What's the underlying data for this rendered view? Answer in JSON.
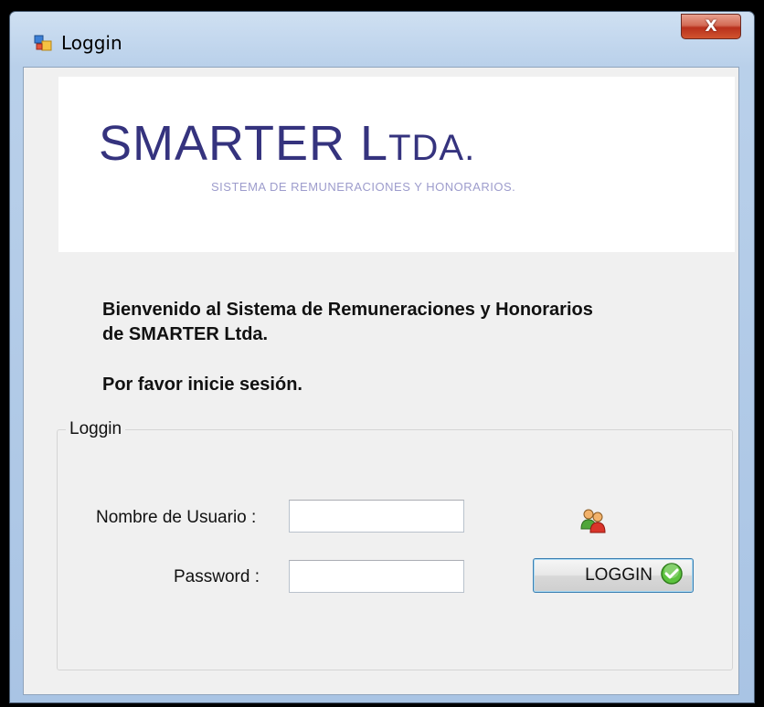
{
  "window": {
    "title": "Loggin",
    "close_glyph": "X"
  },
  "banner": {
    "brand_main": "SMARTER L",
    "brand_smallcaps": "TDA.",
    "tagline": "SISTEMA DE REMUNERACIONES Y HONORARIOS."
  },
  "welcome": {
    "line1": "Bienvenido al Sistema de Remuneraciones y Honorarios",
    "line2": "de SMARTER Ltda.",
    "prompt": "Por favor inicie sesión."
  },
  "login_group": {
    "legend": "Loggin",
    "username_label": "Nombre de Usuario :",
    "username_value": "",
    "password_label": "Password :",
    "password_value": "",
    "button_label": "LOGGIN",
    "users_icon": "users-icon",
    "check_icon": "check-icon"
  },
  "colors": {
    "brand": "#35337e",
    "tagline": "#9d9ccc",
    "check": "#4caf2c"
  }
}
